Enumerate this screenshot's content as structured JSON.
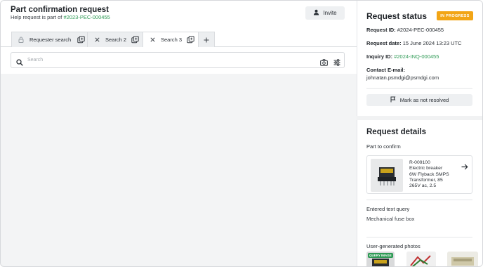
{
  "header": {
    "title": "Part confirmation request",
    "subtitle_prefix": "Help request is part of",
    "subtitle_link": "#2023-PEC-000455",
    "invite_label": "Invite"
  },
  "tabs": [
    {
      "label": "Requester search",
      "leading_icon": "lock-icon"
    },
    {
      "label": "Search 2",
      "leading_icon": "close-icon"
    },
    {
      "label": "Search 3",
      "leading_icon": "close-icon"
    }
  ],
  "search": {
    "placeholder": "Search"
  },
  "status": {
    "title": "Request status",
    "badge": "IN PROGRESS",
    "request_id_label": "Request ID:",
    "request_id": "#2024-PEC-000455",
    "request_date_label": "Request date:",
    "request_date": "15 June 2024 13:23 UTC",
    "inquiry_id_label": "Inquiry ID:",
    "inquiry_id": "#2024-INQ-000455",
    "contact_label": "Contact E-mail:",
    "contact_email": "johnatan.psmdgi@psmdgi.com",
    "mark_label": "Mark as not resolved"
  },
  "details": {
    "title": "Request details",
    "part_label": "Part to confirm",
    "part_id": "R-009100",
    "part_line1": "Electric breaker",
    "part_line2": "6W Flyback SMPS",
    "part_line3": "Transformer, 85",
    "part_line4": "265V ac, 2.5",
    "query_label": "Entered text query",
    "query_value": "Mechanical fuse box",
    "photos_label": "User-generated photos",
    "query_image_badge": "QUERY IMAGE"
  },
  "colors": {
    "accent": "#2e9a55",
    "badge": "#f2a516"
  }
}
